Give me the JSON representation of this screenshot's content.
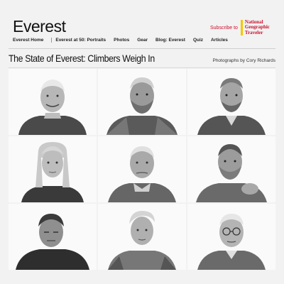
{
  "header": {
    "site_title": "Everest",
    "promo": {
      "text": "Subscribe to",
      "brand_lines": [
        "National",
        "Geographic",
        "Traveler"
      ],
      "brand_color": "#c8102e",
      "brand_bar_color": "#f7c600"
    }
  },
  "nav": {
    "items": [
      {
        "label": "Everest Home",
        "active": false
      },
      {
        "label": "Everest at 50: Portraits",
        "active": true
      },
      {
        "label": "Photos",
        "active": false
      },
      {
        "label": "Gear",
        "active": false
      },
      {
        "label": "Blog: Everest",
        "active": false
      },
      {
        "label": "Quiz",
        "active": false
      },
      {
        "label": "Articles",
        "active": false
      }
    ]
  },
  "page": {
    "title": "The State of Everest: Climbers Weigh In",
    "credit": "Photographs by Cory Richards"
  },
  "portraits": [
    {
      "icon": "portrait-older-man-smiling-icon"
    },
    {
      "icon": "portrait-bearded-man-icon"
    },
    {
      "icon": "portrait-bearded-man-icon"
    },
    {
      "icon": "portrait-woman-long-hair-icon"
    },
    {
      "icon": "portrait-older-man-icon"
    },
    {
      "icon": "portrait-bearded-man-gesturing-icon"
    },
    {
      "icon": "portrait-man-eyes-closed-icon"
    },
    {
      "icon": "portrait-young-man-icon"
    },
    {
      "icon": "portrait-man-glasses-icon"
    }
  ]
}
